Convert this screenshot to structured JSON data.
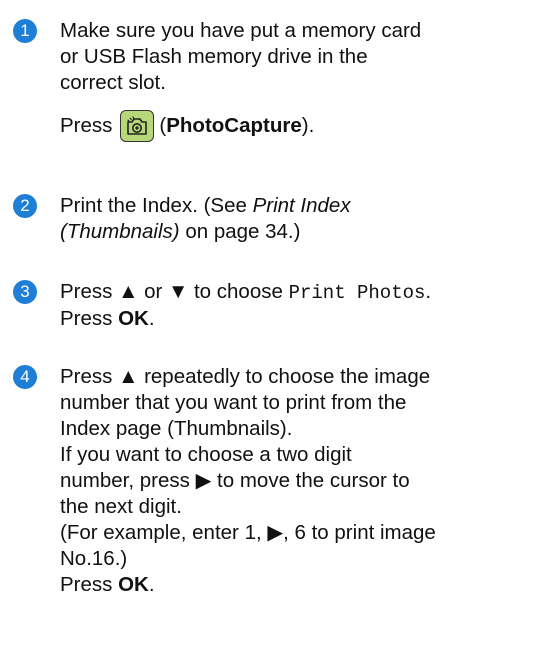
{
  "steps": [
    {
      "number": "1",
      "lines": [
        "Make sure you have put a memory card",
        "or USB Flash memory drive in the",
        "correct slot."
      ],
      "press_prefix": "Press",
      "button_icon": "camera-icon",
      "button_label": "PhotoCapture",
      "press_suffix_open": "(",
      "press_suffix_close": ")."
    },
    {
      "number": "2",
      "line1": "Print the Index. (See ",
      "line1_italic": "Print Index",
      "line2_italic": "(Thumbnails)",
      "line2_rest": " on page 34.)"
    },
    {
      "number": "3",
      "line1_a": "Press ▲ or ▼ to choose ",
      "line1_mono": "Print Photos",
      "line1_end": ".",
      "line2_a": "Press ",
      "line2_bold": "OK",
      "line2_end": "."
    },
    {
      "number": "4",
      "lines": [
        "Press ▲ repeatedly to choose the image",
        "number that you want to print from the",
        "Index page (Thumbnails).",
        "If you want to choose a two digit",
        "number, press ▶ to move the cursor to",
        "the next digit.",
        "(For example, enter 1, ▶, 6 to print image",
        "No.16.)"
      ],
      "last_a": "Press ",
      "last_bold": "OK",
      "last_end": "."
    }
  ],
  "colors": {
    "step_circle": "#1f7ed6",
    "button_bg": "#b7d878"
  }
}
